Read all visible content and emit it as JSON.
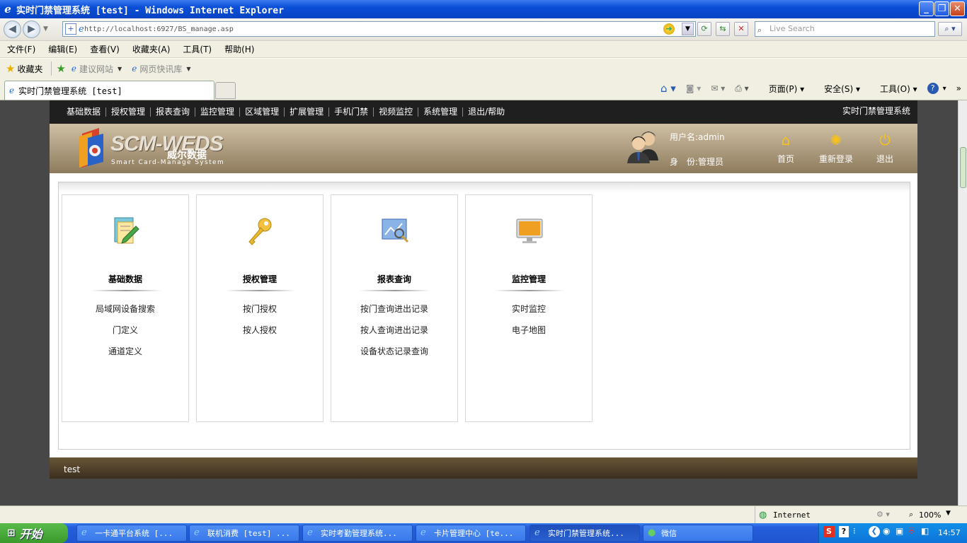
{
  "window": {
    "title": "实时门禁管理系统 [test] - Windows Internet Explorer"
  },
  "address": {
    "url": "http://localhost:6927/BS_manage.asp",
    "search_placeholder": "Live Search"
  },
  "menu": [
    "文件(F)",
    "编辑(E)",
    "查看(V)",
    "收藏夹(A)",
    "工具(T)",
    "帮助(H)"
  ],
  "favorites": {
    "label": "收藏夹",
    "items": [
      "建议网站",
      "网页快讯库"
    ]
  },
  "tab": {
    "label": "实时门禁管理系统 [test]"
  },
  "commands": {
    "page": "页面(P)",
    "safety": "安全(S)",
    "tools": "工具(O)"
  },
  "app": {
    "nav": [
      "基础数据",
      "授权管理",
      "报表查询",
      "监控管理",
      "区域管理",
      "扩展管理",
      "手机门禁",
      "视频监控",
      "系统管理",
      "退出/帮助"
    ],
    "system_name": "实时门禁管理系统",
    "logo": {
      "text": "SCM-WEDS",
      "cn": "威尔数据",
      "sub": "Smart Card-Manage System"
    },
    "user": {
      "name_line": "用户名:admin",
      "role_line": "身　份:管理员"
    },
    "header_buttons": [
      {
        "label": "首页",
        "icon": "home-icon"
      },
      {
        "label": "重新登录",
        "icon": "refresh-icon"
      },
      {
        "label": "退出",
        "icon": "power-icon"
      }
    ],
    "cards": [
      {
        "title": "基础数据",
        "icon": "edit-document-icon",
        "links": [
          "局域网设备搜索",
          "门定义",
          "通道定义"
        ]
      },
      {
        "title": "授权管理",
        "icon": "key-icon",
        "links": [
          "按门授权",
          "按人授权"
        ]
      },
      {
        "title": "报表查询",
        "icon": "report-chart-icon",
        "links": [
          "按门查询进出记录",
          "按人查询进出记录",
          "设备状态记录查询"
        ]
      },
      {
        "title": "监控管理",
        "icon": "monitor-icon",
        "links": [
          "实时监控",
          "电子地图"
        ]
      }
    ],
    "footer": "test"
  },
  "status": {
    "zone": "Internet",
    "zoom": "100%"
  },
  "taskbar": {
    "start": "开始",
    "tasks": [
      "一卡通平台系统 [...",
      "联机消费 [test] ...",
      "实时考勤管理系统...",
      "卡片管理中心 [te...",
      "实时门禁管理系统...",
      "微信"
    ],
    "clock": "14:57"
  }
}
